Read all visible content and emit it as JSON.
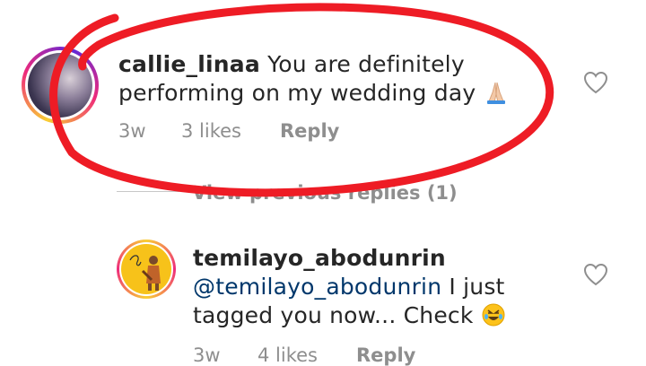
{
  "comments": [
    {
      "username": "callie_linaa",
      "text": "You are definitely performing on my wedding day",
      "emoji": "folded-hands",
      "time": "3w",
      "likes": "3 likes",
      "reply_label": "Reply"
    },
    {
      "username": "temilayo_abodunrin",
      "mention": "@temilayo_abodunrin",
      "text": "I just tagged you now... Check",
      "emoji": "rolling-on-floor-laughing",
      "time": "3w",
      "likes": "4 likes",
      "reply_label": "Reply"
    }
  ],
  "view_previous_replies": "View previous replies (1)",
  "annotation_color": "#ee1c25"
}
